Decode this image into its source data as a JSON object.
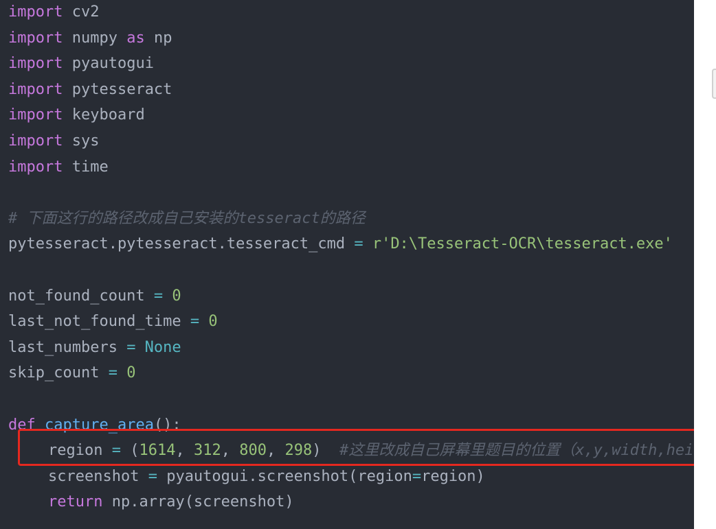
{
  "code": {
    "l1": {
      "kw": "import",
      "mod": " cv2"
    },
    "l2": {
      "kw": "import",
      "mod": " numpy ",
      "kw2": "as",
      "alias": " np"
    },
    "l3": {
      "kw": "import",
      "mod": " pyautogui"
    },
    "l4": {
      "kw": "import",
      "mod": " pytesseract"
    },
    "l5": {
      "kw": "import",
      "mod": " keyboard"
    },
    "l6": {
      "kw": "import",
      "mod": " sys"
    },
    "l7": {
      "kw": "import",
      "mod": " time"
    },
    "comment1": "# 下面这行的路径改成自己安装的tesseract的路径",
    "l9": {
      "lhs": "pytesseract.pytesseract.tesseract_cmd ",
      "op": "=",
      "str": " r'D:\\Tesseract-OCR\\tesseract.exe'"
    },
    "l11": {
      "lhs": "not_found_count ",
      "op": "=",
      "val": " 0"
    },
    "l12": {
      "lhs": "last_not_found_time ",
      "op": "=",
      "val": " 0"
    },
    "l13": {
      "lhs": "last_numbers ",
      "op": "=",
      "val": " None"
    },
    "l14": {
      "lhs": "skip_count ",
      "op": "=",
      "val": " 0"
    },
    "l16": {
      "kw": "def",
      "fn": " capture_area",
      "rest": "():"
    },
    "l17": {
      "lhs": "region ",
      "op": "=",
      "open": " (",
      "n1": "1614",
      "c1": ", ",
      "n2": "312",
      "c2": ", ",
      "n3": "800",
      "c3": ", ",
      "n4": "298",
      "close": ")",
      "comment": "  #这里改成自己屏幕里题目的位置（x,y,width,height）"
    },
    "l18": {
      "lhs": "screenshot ",
      "op": "=",
      "mid": " pyautogui.screenshot(region",
      "op2": "=",
      "rest": "region)"
    },
    "l19": {
      "kw": "return",
      "rest": " np.array(screenshot)"
    }
  },
  "colors": {
    "background": "#282c34",
    "keyword": "#c678dd",
    "number": "#98c379",
    "string": "#98c379",
    "operator": "#56b6c2",
    "comment": "#5c6370",
    "function": "#61afef",
    "highlight_border": "#e5281f"
  }
}
